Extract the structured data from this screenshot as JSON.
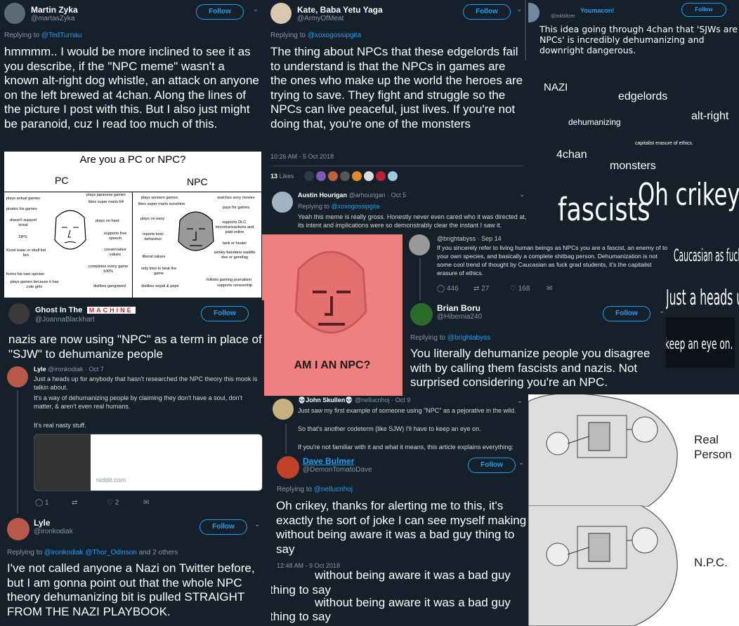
{
  "t1": {
    "name": "Martin Zyka",
    "handle": "@martasZyka",
    "follow": "Follow",
    "reply_prefix": "Replying to",
    "reply_to": "@TedTurnau",
    "text": "hmmmm.. I would be more inclined to see it as you describe, if the \"NPC meme\" wasn't a known alt-right dog whistle, an attack on anyone on the left brewed at 4chan. Along the lines of the picture I post with this. But I also just might be paranoid, cuz I read too much of this."
  },
  "chart": {
    "title": "Are you a PC or NPC?",
    "pc_label": "PC",
    "npc_label": "NPC",
    "pc_left": [
      "plays actual games",
      "pirates his games",
      "doesn't support isreal",
      "DPS",
      "Krool isaac or skull kid bro",
      "forms his own opinion",
      "plays games because it has cute girls"
    ],
    "pc_right": [
      "plays japanese games",
      "likes super mario 64",
      "plays on hard",
      "supports free speech",
      "conservative values",
      "completes every game 100%",
      "dislikes gangweed"
    ],
    "npc_left": [
      "plays western games",
      "likes super mario sunshine",
      "plays on easy",
      "reports toxic behaviour",
      "liberal values",
      "only tries to beat the game",
      "dislikes wojak & pepe"
    ],
    "npc_right": [
      "watches sony movies",
      "pays for games",
      "supports DLC, microtransactions and paid online",
      "tank or healer",
      "ashley-bandana waddle dee or genofag",
      "follows gaming journalism",
      "supports censorship"
    ]
  },
  "t2": {
    "name": "Kate, Baba Yetu Yaga",
    "handle": "@ArmyOfMeat",
    "follow": "Follow",
    "reply_prefix": "Replying to",
    "reply_to": "@xoxogossipgita",
    "text": "The thing about NPCs that these edgelords fail to understand is that the NPCs in games are the ones who make up the world the heroes are trying to save.  They fight and struggle so the NPCs can live peaceful, just lives. If you're not doing that, you're one of the monsters",
    "time": "10:26 AM - 5 Oct 2018",
    "likes_count": "13",
    "likes_label": "Likes"
  },
  "t3": {
    "name": "Youmacon!",
    "handle": "@inkblitzer",
    "follow": "Follow",
    "text": "This idea going through 4chan that 'SJWs are NPCs' is incredibly dehumanizing and downright dangerous."
  },
  "words": {
    "nazi": "NAZI",
    "edgelords": "edgelords",
    "altright": "alt-right",
    "dehumanizing": "dehumanizing",
    "capitalist": "capitalist erasure of ethics.",
    "fourchan": "4chan",
    "monsters": "monsters",
    "fascists": "fascists",
    "crikey": "Oh crikey,",
    "caucasian": "Caucasian as fuck",
    "heads": "Just a heads up",
    "keep": "keep an eye on."
  },
  "t4": {
    "name": "Austin Hourigan",
    "handle": "@arhourigan · Oct 5",
    "reply_prefix": "Replying to",
    "reply_to": "@xoxogossipgita",
    "text": "Yeah this meme is really gross. Honestly never even cared who it was directed at, its intent and implications were so demonstrably clear the instant I saw it."
  },
  "npc_card": {
    "caption": "AM I AN NPC?",
    "bg": "#f08080"
  },
  "t5": {
    "handle": "@brightabyss · Sep 14",
    "text": "If you sincerely refer to living human beings as NPCs you are a fascist, an enemy of to your own species, and basically a complete shitbag person. Dehumanization is not some cool trend of thought by Caucasian as fuck grad students, it's the capitalist erasure of ethics.",
    "replies": "446",
    "retweets": "27",
    "likes": "168"
  },
  "t6": {
    "name": "Brian Boru",
    "handle": "@Hibernia240",
    "follow": "Follow",
    "reply_prefix": "Replying to",
    "reply_to": "@brightabyss",
    "text": "You literally dehumanize people you disagree with by calling them fascists and nazis. Not surprised considering you're an NPC."
  },
  "t7": {
    "name": "Ghost In The",
    "name_box": "MACHINE",
    "handle": "@JoannaBlackhart",
    "follow": "Follow",
    "text": "nazis are now using \"NPC\" as a term in place of \"SJW\" to dehumanize people"
  },
  "t8": {
    "name": "Lyle",
    "handle": "@ironkodiak · Oct 7",
    "line1": "Just a heads up for anybody that hasn't researched the NPC theory this mook is talkin about.",
    "line2": "It's a way of dehumanizing people by claiming they don't have a soul, don't matter, & aren't even real humans.",
    "line3": "It's real nasty stuff.",
    "link": "reddit.com",
    "replies": "1",
    "likes": "2"
  },
  "t9": {
    "name": "Lyle",
    "handle": "@ironkodiak",
    "follow": "Follow",
    "reply_prefix": "Replying to",
    "reply_to": "@ironkodiak @Thor_Odinson",
    "reply_suffix": "and 2 others",
    "text": "I've not called anyone a Nazi on Twitter before, but I am gonna point out that the whole NPC theory dehumanizing bit is pulled STRAIGHT FROM THE NAZI PLAYBOOK."
  },
  "t10": {
    "name": "John Skullen",
    "handle": "@nellucnhoj · Oct 9",
    "line1": "Just saw my first example of someone using \"NPC\" as a pejorative in the wild.",
    "line2": "So that's another codeterm (like SJW) I'll have to keep an eye on.",
    "line3": "If you're not familiar with it and what it means, this article explains everything:"
  },
  "t11": {
    "name": "Dave Bulmer",
    "handle": "@DemonTomatoDave",
    "follow": "Follow",
    "reply_prefix": "Replying to",
    "reply_to": "@nellucnhoj",
    "text": "Oh crikey, thanks for alerting me to this, it's exactly the sort of joke I can see myself making without being aware it was a bad guy thing to say",
    "time": "12:48 AM - 9 Oct 2018",
    "repeat": "without being aware it was a bad guy",
    "repeat2": "thing to say"
  },
  "panel": {
    "real": "Real Person",
    "npc": "N.P.C."
  }
}
